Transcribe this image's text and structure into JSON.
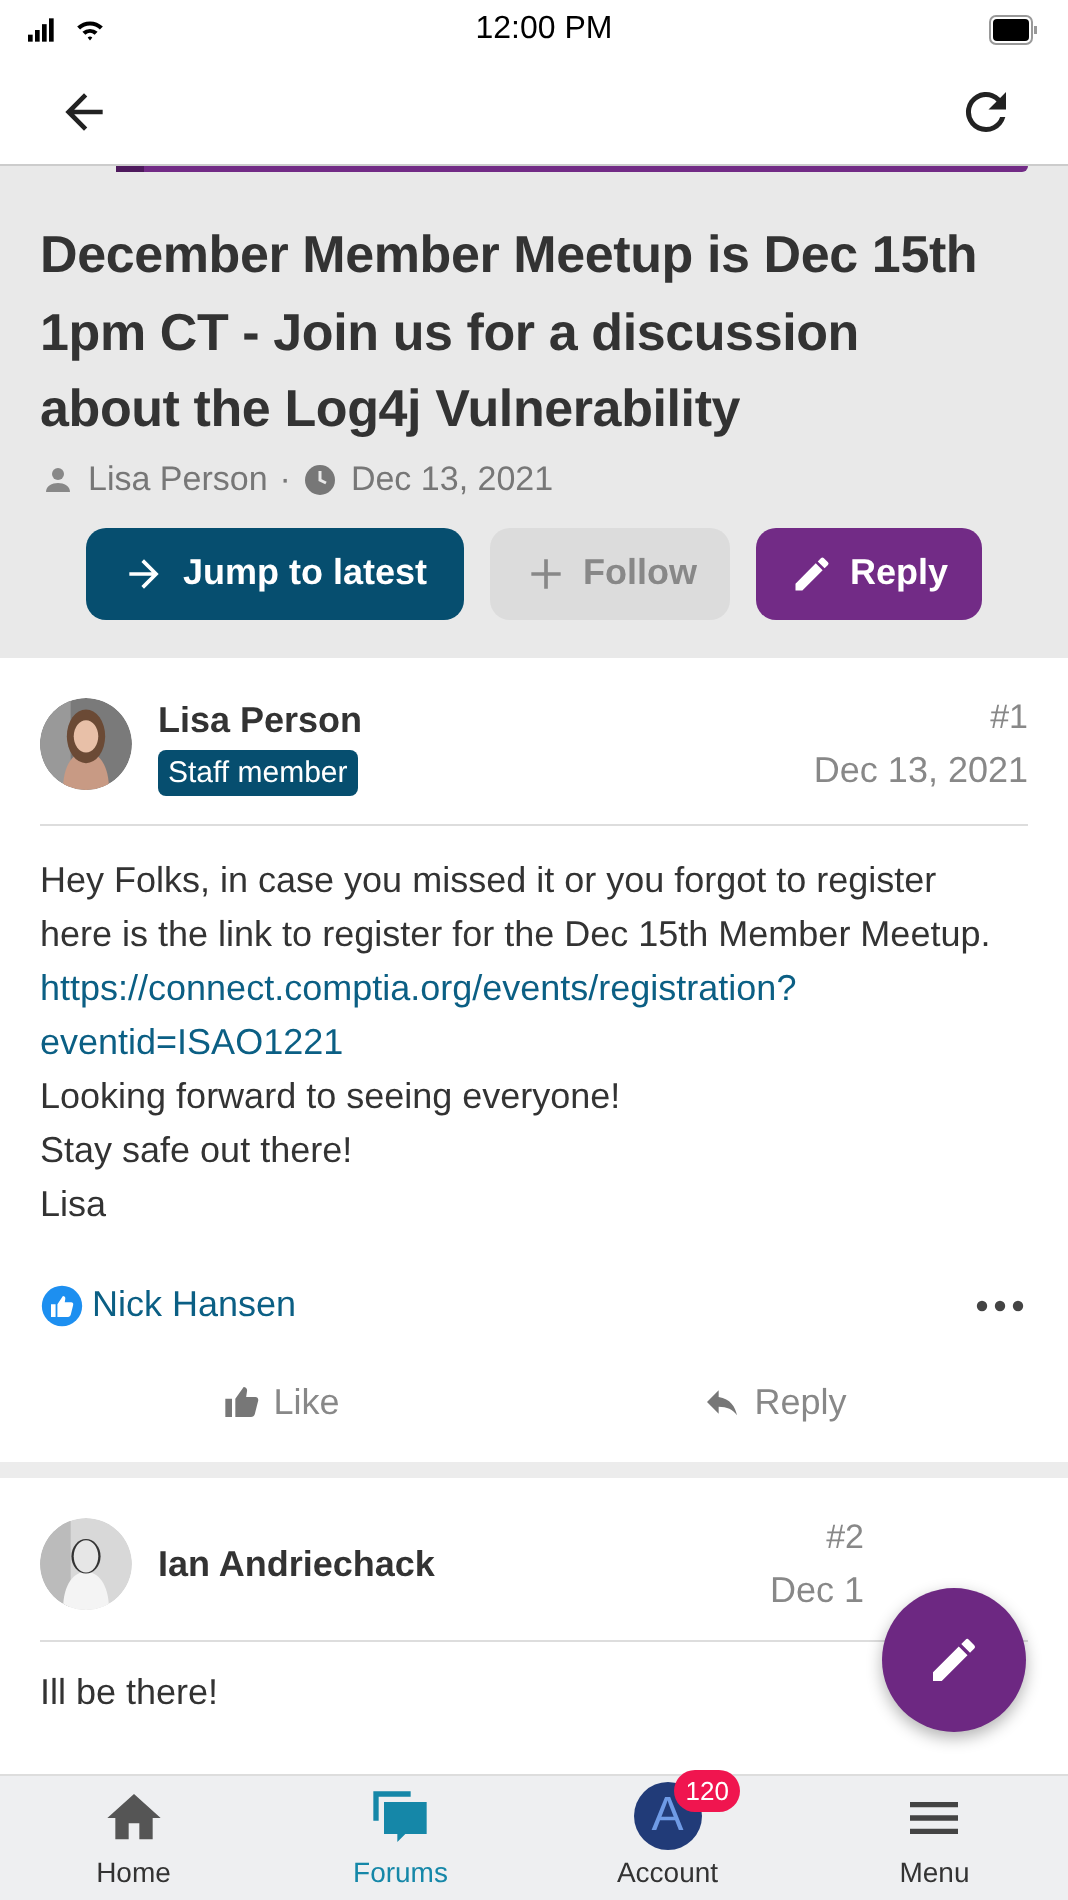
{
  "status_bar": {
    "time": "12:00 PM"
  },
  "progress": {
    "level": 0.03
  },
  "topic": {
    "title": "December Member Meetup is Dec 15th 1pm CT - Join us for a discussion about the Log4j Vulnerability",
    "author": "Lisa Person",
    "separator": "·",
    "date": "Dec 13, 2021"
  },
  "topic_buttons": [
    {
      "kind": "jump",
      "label": "Jump to latest"
    },
    {
      "kind": "follow",
      "label": "Follow"
    },
    {
      "kind": "reply",
      "label": "Reply"
    }
  ],
  "posts": [
    {
      "author": "Lisa Person",
      "badge": "Staff member",
      "number": "#1",
      "date": "Dec 13, 2021",
      "body": [
        "Hey Folks, in case you missed it or you forgot to register here is the link to register for the Dec 15th Member Meetup."
      ],
      "link": "https://connect.comptia.org/events/registration?eventid=ISAO1221",
      "body_after": [
        "Looking forward to seeing everyone!",
        "Stay safe out there!",
        "Lisa"
      ],
      "liked_by": "Nick Hansen",
      "actions": [
        "Like",
        "Reply"
      ]
    },
    {
      "author": "Ian Andriechack",
      "number": "#2",
      "date": "Dec 1",
      "body": [
        "Ill be there!"
      ]
    }
  ],
  "nav": [
    {
      "kind": "home",
      "label": "Home",
      "selected": false
    },
    {
      "kind": "forums",
      "label": "Forums",
      "selected": true
    },
    {
      "kind": "account",
      "label": "Account",
      "selected": false,
      "avatar": "A",
      "count": "120"
    },
    {
      "kind": "menu",
      "label": "Menu",
      "selected": false
    }
  ]
}
